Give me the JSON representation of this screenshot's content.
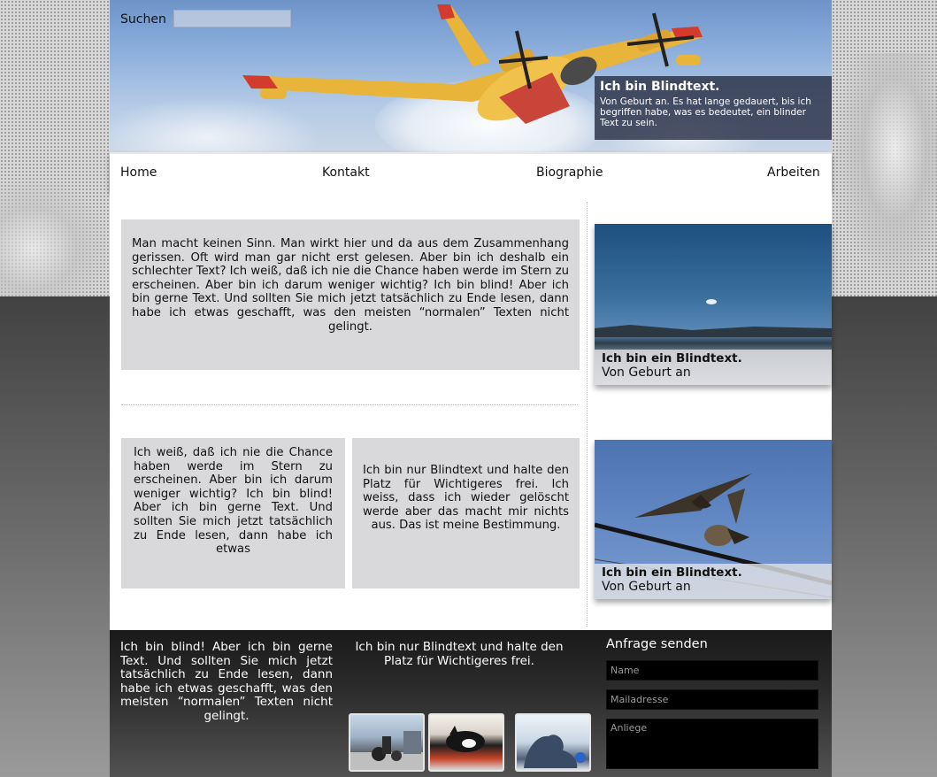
{
  "header": {
    "search_label": "Suchen",
    "search_value": "",
    "caption_title": "Ich bin Blindtext.",
    "caption_text": "Von Geburt an. Es hat lange gedauert, bis ich begriffen habe, was es bedeutet, ein blinder Text zu sein."
  },
  "nav": {
    "items": [
      {
        "label": "Home"
      },
      {
        "label": "Kontakt"
      },
      {
        "label": "Biographie"
      },
      {
        "label": "Arbeiten"
      }
    ]
  },
  "main": {
    "box1": "Man macht keinen Sinn. Man wirkt hier und da aus dem Zusammenhang gerissen. Oft wird man gar nicht erst gelesen. Aber bin ich deshalb ein schlechter Text? Ich weiß, daß ich nie die Chance haben werde im Stern zu erscheinen. Aber bin ich darum weniger wichtig? Ich bin blind! Aber ich bin gerne Text. Und sollten Sie mich jetzt tatsächlich zu Ende lesen, dann habe ich etwas geschafft, was den meisten “normalen” Texten nicht gelingt.",
    "box2": "Ich weiß, daß ich nie die Chance haben werde im Stern zu erscheinen. Aber bin ich darum weniger wichtig? Ich bin blind! Aber ich bin gerne Text. Und sollten Sie mich jetzt tatsächlich zu Ende lesen, dann habe ich etwas",
    "box3": "Ich bin nur Blindtext und halte den Platz für Wichtigeres frei. Ich weiss, dass ich wieder gelöscht werde aber das macht mir nichts aus. Das ist meine Bestimmung."
  },
  "sidebar": {
    "photos": [
      {
        "title": "Ich bin ein Blindtext.",
        "subtitle": "Von Geburt an"
      },
      {
        "title": "Ich bin ein Blindtext.",
        "subtitle": "Von Geburt an"
      }
    ]
  },
  "footer": {
    "col1": "Ich bin blind! Aber ich bin gerne Text. Und sollten Sie mich jetzt tatsächlich zu Ende lesen, dann habe ich etwas geschafft, was den meisten “normalen” Texten nicht gelingt.",
    "col2": "Ich bin nur Blindtext und halte den Platz für Wichtigeres frei.",
    "form": {
      "title": "Anfrage senden",
      "name_placeholder": "Name",
      "mail_placeholder": "Mailadresse",
      "message_placeholder": "Anliege"
    }
  },
  "colors": {
    "content_box": "#d9d9dc",
    "footer_bg": "#1a1a1a",
    "caption_bg": "#283046"
  }
}
